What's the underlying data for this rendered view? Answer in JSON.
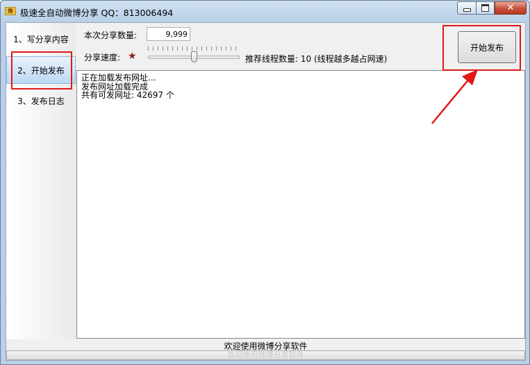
{
  "window": {
    "title": "极速全自动微博分享 QQ：813006494",
    "icon": "weibo-share-app-icon",
    "icon_text": "微"
  },
  "nav": {
    "items": [
      {
        "label": "1、写分享内容"
      },
      {
        "label": "2、开始发布",
        "active": true
      },
      {
        "label": "3、发布日志"
      }
    ]
  },
  "settings": {
    "count_label": "本次分享数量:",
    "count_value": "9,999",
    "speed_label": "分享速度:",
    "speed_icon": "star-icon",
    "threads_text": "推荐线程数量: 10 (线程越多越占网速)",
    "speed_level": 0.5
  },
  "start_button": {
    "label": "开始发布"
  },
  "log": {
    "lines": [
      "正在加载发布网址...",
      "发布网址加载完成",
      "共有可发网址: 42697 个"
    ]
  },
  "status": {
    "text": "欢迎使用微博分享软件",
    "progress_text": "欢迎使用微博分享软件"
  },
  "colors": {
    "annotation": "#e01818",
    "nav_active": "#bcd8f2"
  }
}
